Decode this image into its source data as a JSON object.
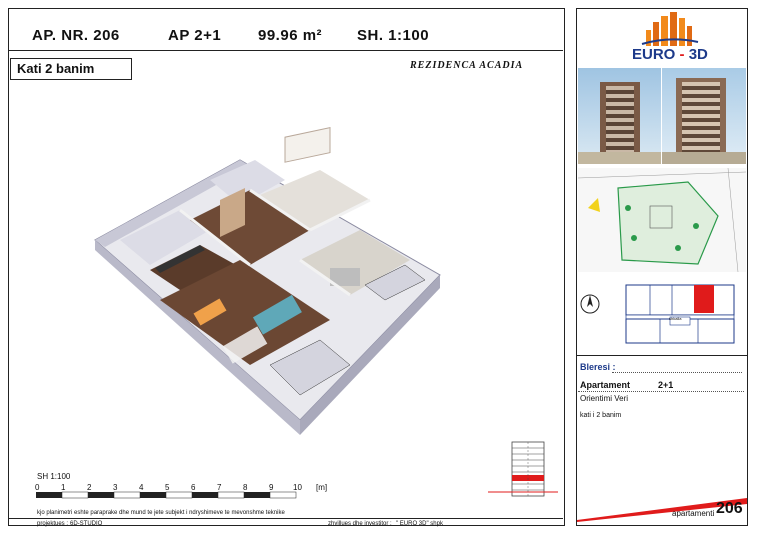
{
  "header": {
    "ap_nr": "AP. NR. 206",
    "ap_type": "AP 2+1",
    "area": "99.96 m²",
    "scale": "SH. 1:100"
  },
  "floor_box": {
    "label": "Kati 2 banim"
  },
  "project_name": "REZIDENCA ACADIA",
  "logo": {
    "brand_left": "EURO",
    "brand_sep": "-",
    "brand_right": "3D"
  },
  "info": {
    "bleresi_label": "Bleresi :",
    "apartment_label": "Apartament",
    "apartment_type": "2+1",
    "orientation": "Orientimi  Veri",
    "floor": "kati i 2 banim"
  },
  "footer": {
    "note": "kjo planimetri eshte paraprake dhe mund te jete subjekt i ndryshimeve te mevonshme teknike",
    "projektues_label": "projektues :",
    "projektues_value": "6D-STUDIO",
    "investitor_label": "zhvillues dhe investitor :",
    "investitor_value": "\" EURO 3D\" shpk",
    "apartment_word": "apartamenti",
    "apartment_number": "206"
  },
  "scale_bar": {
    "label": "SH 1:100",
    "ticks": [
      "0",
      "1",
      "2",
      "3",
      "4",
      "5",
      "6",
      "7",
      "8",
      "9",
      "10"
    ],
    "unit": "[m]"
  },
  "mini_plan": {
    "label": "shkalla"
  },
  "colors": {
    "accent_red": "#e01b1b",
    "logo_orange": "#f28a1b",
    "logo_blue": "#1d3a8a"
  }
}
